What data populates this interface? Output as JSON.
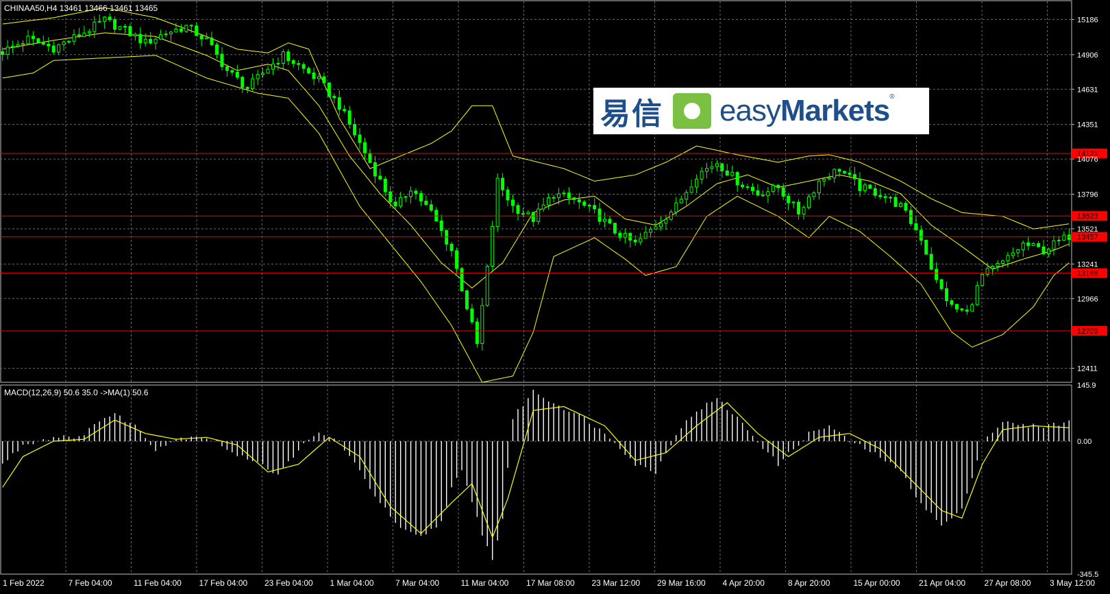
{
  "header": {
    "symbol_info": "CHINAA50,H4  13461 13466 13461 13465"
  },
  "macd_header": {
    "label": "MACD(12,26,9) 50.6 35.0  ->MA(1) 50.6"
  },
  "logo": {
    "cn": "易信",
    "en_light": "easy",
    "en_bold": "Markets",
    "reg": "®"
  },
  "colors": {
    "background": "#000000",
    "grid": "#6b6b6b",
    "candle": "#00ff00",
    "band": "#ffff00",
    "level_line": "#ff0000",
    "level_label_bg": "#ff0000",
    "macd_hist": "#ffffff",
    "macd_signal": "#ffff00"
  },
  "chart_data": [
    {
      "type": "line",
      "name_hint": "price-panel",
      "ylim": [
        12300,
        15330
      ],
      "y_ticks": [
        "15186",
        "14906",
        "14631",
        "14351",
        "14076",
        "13796",
        "13521",
        "13241",
        "12966",
        "12411"
      ],
      "y_tick_values": [
        15186,
        14906,
        14631,
        14351,
        14076,
        13796,
        13521,
        13241,
        12966,
        12411
      ],
      "levels": [
        {
          "label": "14121",
          "value": 14121
        },
        {
          "label": "13623",
          "value": 13623
        },
        {
          "label": "13457",
          "value": 13457
        },
        {
          "label": "13168",
          "value": 13168
        },
        {
          "label": "12709",
          "value": 12709
        }
      ],
      "x_labels": [
        "1 Feb 2022",
        "7 Feb 04:00",
        "11 Feb 04:00",
        "17 Feb 04:00",
        "23 Feb 04:00",
        "1 Mar 04:00",
        "7 Mar 04:00",
        "11 Mar 04:00",
        "17 Mar 08:00",
        "23 Mar 12:00",
        "29 Mar 16:00",
        "4 Apr 20:00",
        "8 Apr 20:00",
        "15 Apr 00:00",
        "21 Apr 04:00",
        "27 Apr 08:00",
        "3 May 12:00"
      ],
      "close_path": [
        [
          0,
          14930
        ],
        [
          5,
          15030
        ],
        [
          10,
          14960
        ],
        [
          15,
          15060
        ],
        [
          20,
          15180
        ],
        [
          24,
          15100
        ],
        [
          28,
          15000
        ],
        [
          32,
          15080
        ],
        [
          36,
          15130
        ],
        [
          40,
          15020
        ],
        [
          44,
          14780
        ],
        [
          48,
          14640
        ],
        [
          52,
          14800
        ],
        [
          55,
          14900
        ],
        [
          58,
          14820
        ],
        [
          62,
          14700
        ],
        [
          66,
          14500
        ],
        [
          70,
          14200
        ],
        [
          74,
          13900
        ],
        [
          77,
          13680
        ],
        [
          80,
          13850
        ],
        [
          84,
          13650
        ],
        [
          88,
          13350
        ],
        [
          91,
          12900
        ],
        [
          93,
          12600
        ],
        [
          95,
          13200
        ],
        [
          97,
          13900
        ],
        [
          100,
          13700
        ],
        [
          104,
          13600
        ],
        [
          108,
          13800
        ],
        [
          112,
          13750
        ],
        [
          116,
          13650
        ],
        [
          120,
          13500
        ],
        [
          124,
          13400
        ],
        [
          128,
          13550
        ],
        [
          132,
          13700
        ],
        [
          136,
          13950
        ],
        [
          140,
          14050
        ],
        [
          144,
          13900
        ],
        [
          148,
          13800
        ],
        [
          152,
          13850
        ],
        [
          156,
          13650
        ],
        [
          160,
          13900
        ],
        [
          164,
          14000
        ],
        [
          168,
          13850
        ],
        [
          172,
          13800
        ],
        [
          176,
          13700
        ],
        [
          180,
          13450
        ],
        [
          183,
          13100
        ],
        [
          186,
          12900
        ],
        [
          189,
          12850
        ],
        [
          192,
          13150
        ],
        [
          196,
          13250
        ],
        [
          200,
          13400
        ],
        [
          204,
          13350
        ],
        [
          207,
          13420
        ],
        [
          209,
          13465
        ]
      ],
      "band_upper": [
        [
          0,
          15150
        ],
        [
          10,
          15200
        ],
        [
          20,
          15280
        ],
        [
          30,
          15200
        ],
        [
          40,
          15050
        ],
        [
          46,
          14950
        ],
        [
          52,
          14920
        ],
        [
          56,
          15000
        ],
        [
          60,
          14950
        ],
        [
          66,
          14400
        ],
        [
          72,
          14000
        ],
        [
          78,
          14100
        ],
        [
          84,
          14200
        ],
        [
          88,
          14300
        ],
        [
          92,
          14500
        ],
        [
          96,
          14500
        ],
        [
          100,
          14100
        ],
        [
          110,
          14000
        ],
        [
          116,
          13900
        ],
        [
          124,
          13950
        ],
        [
          130,
          14050
        ],
        [
          136,
          14180
        ],
        [
          144,
          14110
        ],
        [
          152,
          14050
        ],
        [
          158,
          14100
        ],
        [
          162,
          14110
        ],
        [
          168,
          14050
        ],
        [
          176,
          13900
        ],
        [
          182,
          13760
        ],
        [
          188,
          13650
        ],
        [
          196,
          13620
        ],
        [
          202,
          13520
        ],
        [
          209,
          13560
        ]
      ],
      "band_mid": [
        [
          0,
          14950
        ],
        [
          10,
          15020
        ],
        [
          20,
          15080
        ],
        [
          30,
          15050
        ],
        [
          40,
          14900
        ],
        [
          46,
          14780
        ],
        [
          52,
          14830
        ],
        [
          56,
          14780
        ],
        [
          62,
          14500
        ],
        [
          68,
          14100
        ],
        [
          74,
          13800
        ],
        [
          80,
          13550
        ],
        [
          86,
          13250
        ],
        [
          92,
          13050
        ],
        [
          98,
          13250
        ],
        [
          104,
          13650
        ],
        [
          110,
          13750
        ],
        [
          116,
          13780
        ],
        [
          122,
          13600
        ],
        [
          128,
          13550
        ],
        [
          134,
          13700
        ],
        [
          140,
          13880
        ],
        [
          146,
          13950
        ],
        [
          152,
          13850
        ],
        [
          158,
          13900
        ],
        [
          164,
          13950
        ],
        [
          170,
          13900
        ],
        [
          176,
          13800
        ],
        [
          182,
          13550
        ],
        [
          188,
          13380
        ],
        [
          194,
          13200
        ],
        [
          200,
          13280
        ],
        [
          206,
          13350
        ],
        [
          209,
          13400
        ]
      ],
      "band_lower": [
        [
          0,
          14720
        ],
        [
          6,
          14760
        ],
        [
          10,
          14860
        ],
        [
          20,
          14880
        ],
        [
          30,
          14900
        ],
        [
          40,
          14720
        ],
        [
          50,
          14600
        ],
        [
          56,
          14560
        ],
        [
          62,
          14280
        ],
        [
          70,
          13700
        ],
        [
          76,
          13400
        ],
        [
          82,
          13100
        ],
        [
          88,
          12750
        ],
        [
          94,
          12300
        ],
        [
          100,
          12350
        ],
        [
          104,
          12700
        ],
        [
          108,
          13300
        ],
        [
          116,
          13450
        ],
        [
          122,
          13280
        ],
        [
          126,
          13150
        ],
        [
          132,
          13220
        ],
        [
          138,
          13620
        ],
        [
          144,
          13780
        ],
        [
          152,
          13620
        ],
        [
          158,
          13450
        ],
        [
          162,
          13620
        ],
        [
          168,
          13500
        ],
        [
          174,
          13300
        ],
        [
          180,
          13080
        ],
        [
          186,
          12700
        ],
        [
          190,
          12580
        ],
        [
          196,
          12680
        ],
        [
          202,
          12900
        ],
        [
          206,
          13150
        ],
        [
          209,
          13250
        ]
      ]
    },
    {
      "type": "bar",
      "name_hint": "macd-panel",
      "ylim": [
        -345.5,
        145.9
      ],
      "y_ticks": [
        "145.9",
        "0.00",
        "-345.5"
      ],
      "y_tick_values": [
        145.9,
        0,
        -345.5
      ],
      "histogram_keys": [
        [
          0,
          -60
        ],
        [
          4,
          -10
        ],
        [
          8,
          5
        ],
        [
          12,
          15
        ],
        [
          16,
          10
        ],
        [
          18,
          50
        ],
        [
          22,
          70
        ],
        [
          26,
          40
        ],
        [
          30,
          -20
        ],
        [
          34,
          5
        ],
        [
          38,
          15
        ],
        [
          42,
          0
        ],
        [
          46,
          -40
        ],
        [
          50,
          -50
        ],
        [
          54,
          -90
        ],
        [
          58,
          -20
        ],
        [
          62,
          20
        ],
        [
          66,
          0
        ],
        [
          70,
          -80
        ],
        [
          74,
          -160
        ],
        [
          78,
          -230
        ],
        [
          82,
          -250
        ],
        [
          86,
          -210
        ],
        [
          88,
          -120
        ],
        [
          90,
          -80
        ],
        [
          94,
          -240
        ],
        [
          96,
          -310
        ],
        [
          98,
          -200
        ],
        [
          100,
          60
        ],
        [
          104,
          130
        ],
        [
          108,
          100
        ],
        [
          114,
          60
        ],
        [
          120,
          0
        ],
        [
          124,
          -60
        ],
        [
          128,
          -80
        ],
        [
          132,
          20
        ],
        [
          136,
          80
        ],
        [
          140,
          110
        ],
        [
          144,
          60
        ],
        [
          148,
          0
        ],
        [
          152,
          -60
        ],
        [
          158,
          20
        ],
        [
          162,
          40
        ],
        [
          166,
          0
        ],
        [
          172,
          -40
        ],
        [
          176,
          -80
        ],
        [
          180,
          -160
        ],
        [
          184,
          -220
        ],
        [
          188,
          -180
        ],
        [
          192,
          0
        ],
        [
          196,
          50
        ],
        [
          200,
          40
        ],
        [
          204,
          40
        ],
        [
          209,
          50
        ]
      ],
      "signal_keys": [
        [
          0,
          -120
        ],
        [
          4,
          -40
        ],
        [
          10,
          0
        ],
        [
          16,
          5
        ],
        [
          22,
          55
        ],
        [
          28,
          20
        ],
        [
          34,
          5
        ],
        [
          40,
          10
        ],
        [
          46,
          -10
        ],
        [
          52,
          -80
        ],
        [
          58,
          -60
        ],
        [
          64,
          10
        ],
        [
          70,
          -40
        ],
        [
          76,
          -170
        ],
        [
          82,
          -240
        ],
        [
          88,
          -160
        ],
        [
          92,
          -110
        ],
        [
          96,
          -250
        ],
        [
          99,
          -150
        ],
        [
          104,
          80
        ],
        [
          110,
          90
        ],
        [
          118,
          40
        ],
        [
          124,
          -50
        ],
        [
          130,
          -30
        ],
        [
          136,
          40
        ],
        [
          142,
          100
        ],
        [
          148,
          20
        ],
        [
          154,
          -40
        ],
        [
          160,
          10
        ],
        [
          166,
          20
        ],
        [
          172,
          -20
        ],
        [
          178,
          -100
        ],
        [
          184,
          -180
        ],
        [
          188,
          -200
        ],
        [
          192,
          -60
        ],
        [
          196,
          30
        ],
        [
          202,
          40
        ],
        [
          209,
          35
        ]
      ]
    }
  ]
}
